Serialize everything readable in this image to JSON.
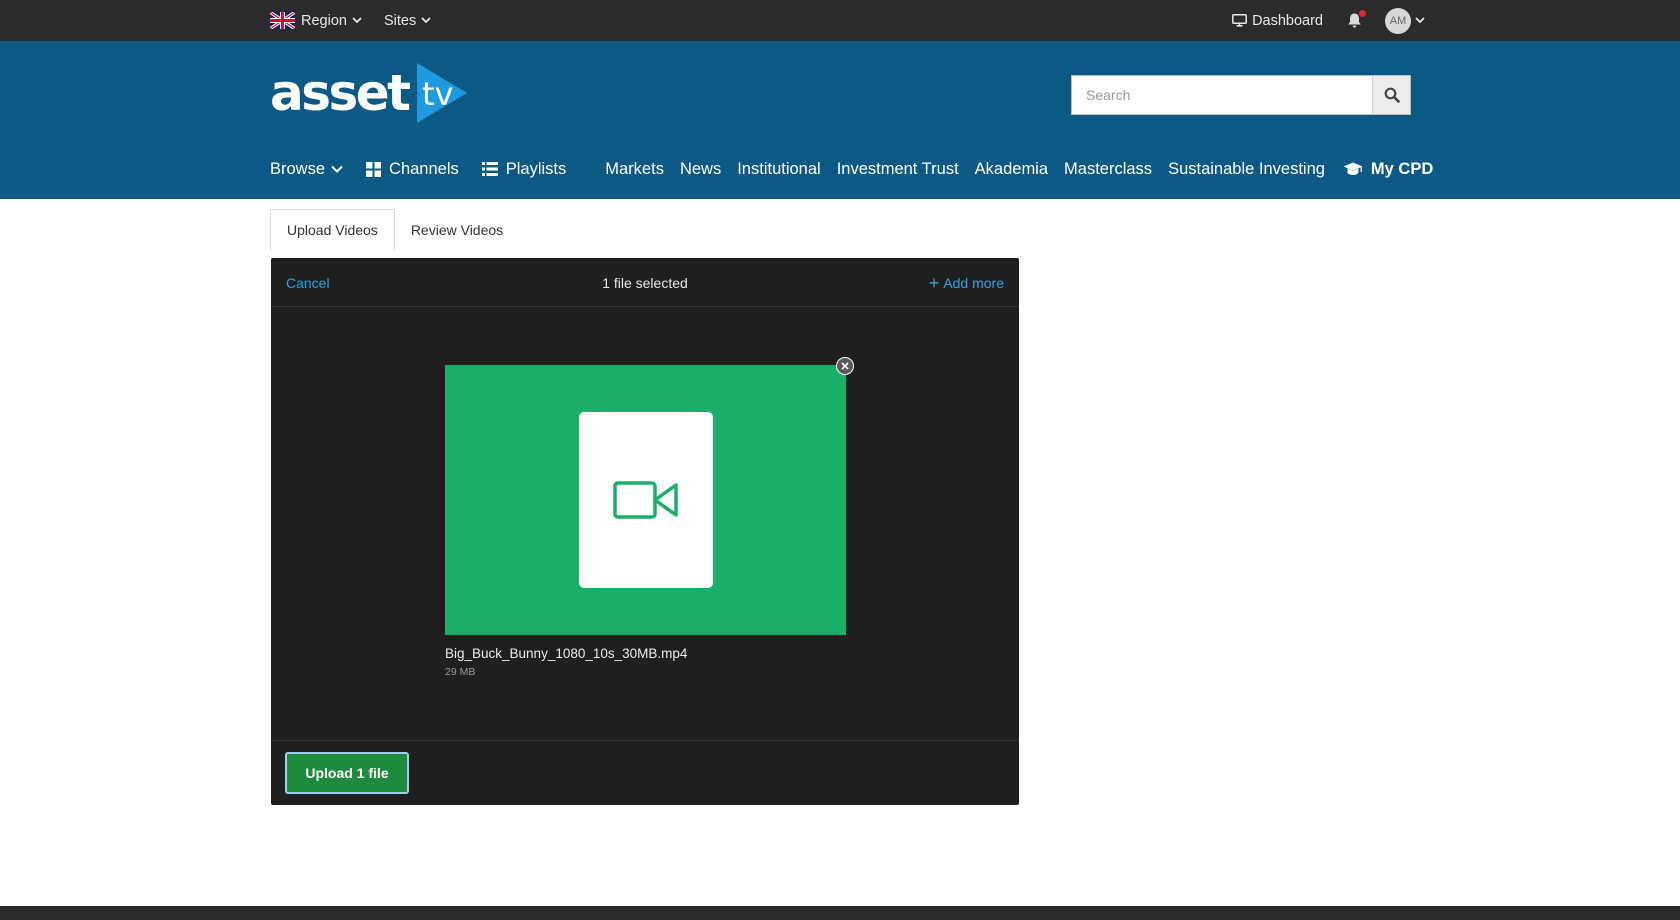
{
  "topbar": {
    "region_label": "Region",
    "sites_label": "Sites",
    "dashboard_label": "Dashboard",
    "avatar_initials": "AM"
  },
  "header": {
    "logo_text": "asset",
    "logo_suffix": "tv",
    "search_placeholder": "Search",
    "search_value": ""
  },
  "nav": {
    "browse": "Browse",
    "channels": "Channels",
    "playlists": "Playlists",
    "links": [
      "Markets",
      "News",
      "Institutional",
      "Investment Trust",
      "Akademia",
      "Masterclass",
      "Sustainable Investing"
    ],
    "my_cpd": "My CPD"
  },
  "tabs": [
    {
      "label": "Upload Videos",
      "active": true
    },
    {
      "label": "Review Videos",
      "active": false
    }
  ],
  "uploader": {
    "cancel_label": "Cancel",
    "selected_text": "1 file selected",
    "add_more_label": "Add more",
    "file": {
      "name": "Big_Buck_Bunny_1080_10s_30MB.mp4",
      "size": "29 MB"
    },
    "upload_button_label": "Upload 1 file"
  },
  "colors": {
    "topbar_bg": "#2b2b2b",
    "header_bg": "#0d5985",
    "panel_bg": "#1f1f1f",
    "thumb_green": "#1bae6b",
    "link_blue": "#2aa4e0",
    "upload_green": "#1e8a3c",
    "notification_red": "#e0262b"
  },
  "icons": {
    "flag": "uk-flag-icon",
    "monitor": "monitor-icon",
    "bell": "bell-icon",
    "search": "search-icon",
    "channels": "grid-icon",
    "playlists": "list-icon",
    "my_cpd": "graduation-cap-icon",
    "file_type": "video-camera-icon",
    "remove": "close-icon"
  }
}
